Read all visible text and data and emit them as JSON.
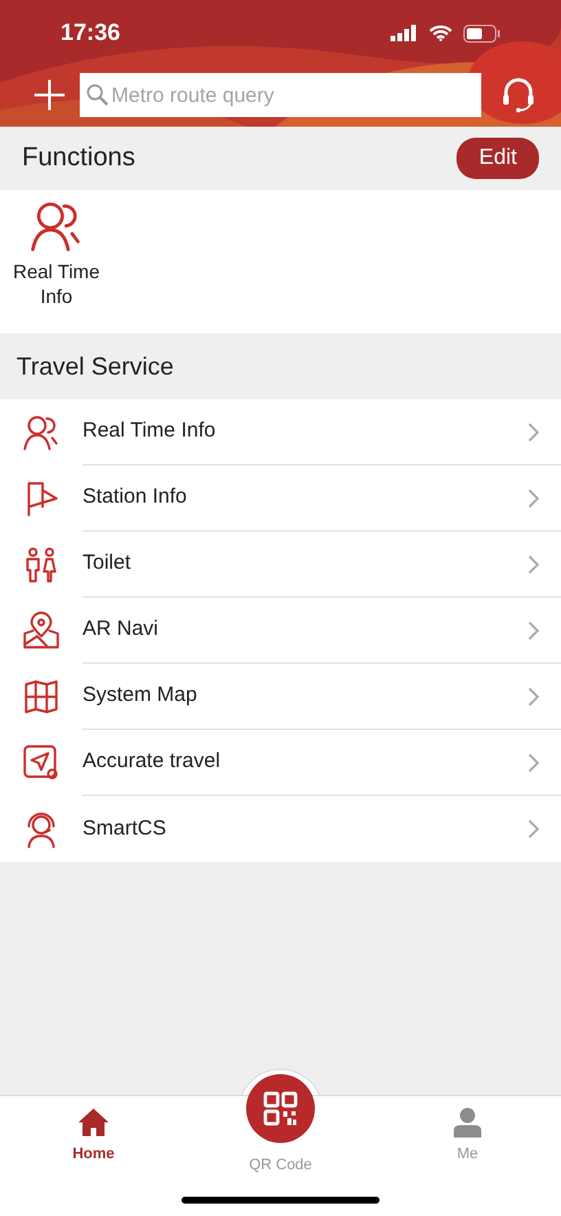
{
  "status_bar": {
    "time": "17:36"
  },
  "header": {
    "search": {
      "placeholder": "Metro route query"
    }
  },
  "functions": {
    "title": "Functions",
    "edit_button": "Edit",
    "items": [
      {
        "label": "Real Time Info",
        "kind": "people"
      }
    ]
  },
  "travel_service": {
    "title": "Travel Service",
    "items": [
      {
        "label": "Real Time Info",
        "kind": "people"
      },
      {
        "label": "Station Info",
        "kind": "flag"
      },
      {
        "label": "Toilet",
        "kind": "toilet"
      },
      {
        "label": "AR Navi",
        "kind": "pinmap"
      },
      {
        "label": "System Map",
        "kind": "map"
      },
      {
        "label": "Accurate travel",
        "kind": "navigate"
      },
      {
        "label": "SmartCS",
        "kind": "agent"
      }
    ]
  },
  "tab_bar": [
    {
      "label": "Home",
      "kind": "home",
      "selected": true
    },
    {
      "label": "QR Code",
      "kind": "qr",
      "selected": false
    },
    {
      "label": "Me",
      "kind": "person",
      "selected": false
    }
  ]
}
